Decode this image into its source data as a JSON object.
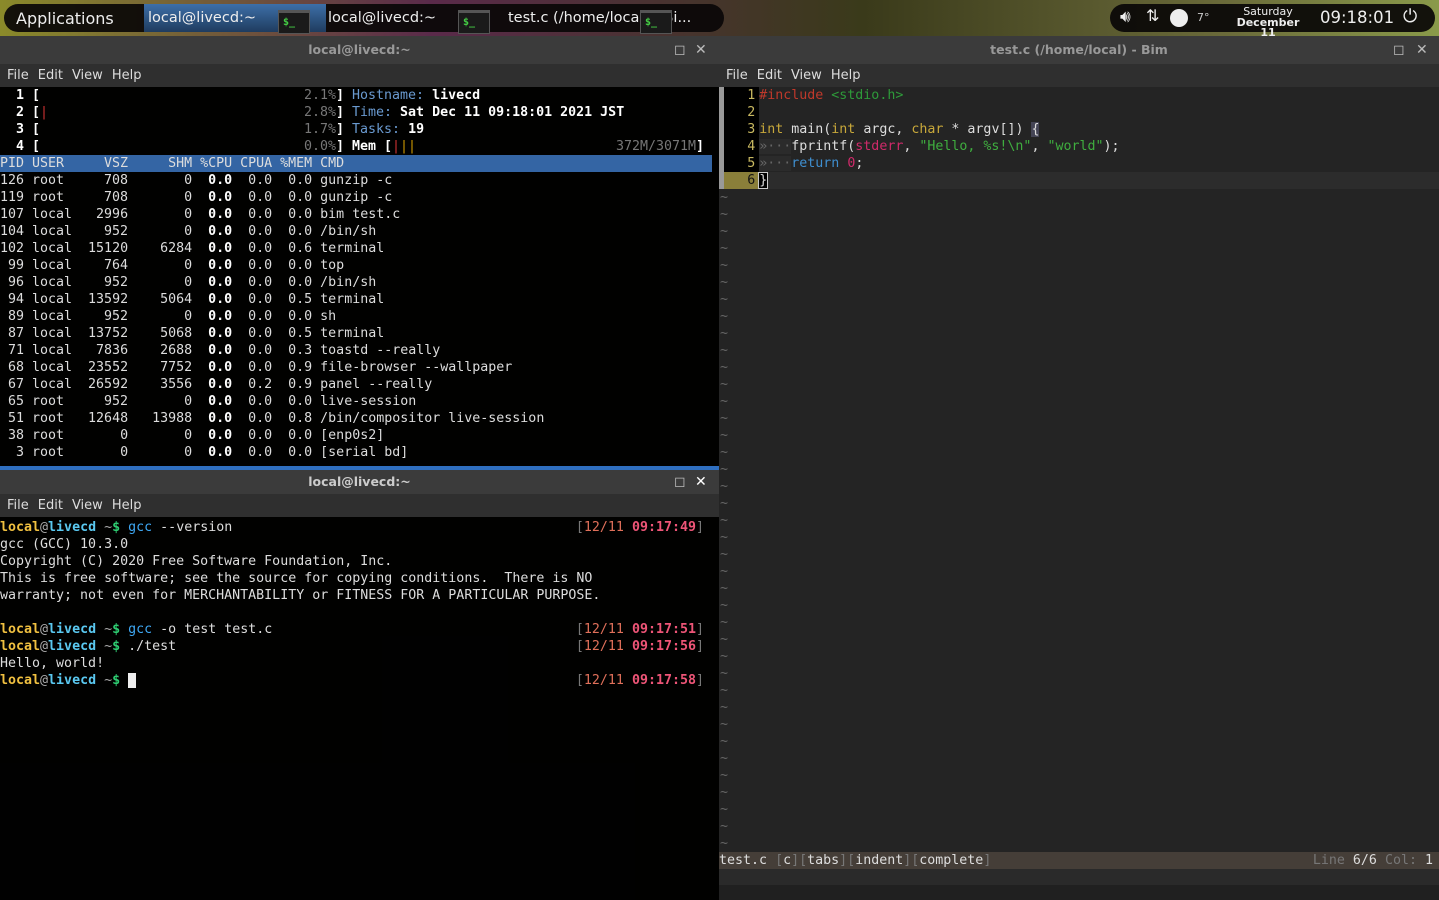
{
  "panel": {
    "applications": "Applications",
    "tasks": [
      {
        "label": "local@livecd:~",
        "active": true
      },
      {
        "label": "local@livecd:~",
        "active": false
      },
      {
        "label": "test.c (/home/local) - Bi...",
        "active": false
      }
    ],
    "task_icon": "$_",
    "weather": "7°",
    "day": "Saturday",
    "date": "December 11",
    "clock": "09:18:01",
    "icons": [
      "volume-icon",
      "network-icon",
      "weather-icon",
      "power-icon"
    ]
  },
  "top_terminal": {
    "title": "local@livecd:~",
    "menu": [
      "File",
      "Edit",
      "View",
      "Help"
    ],
    "meters": [
      {
        "n": "1",
        "pct": "2.1%"
      },
      {
        "n": "2",
        "pct": "2.8%"
      },
      {
        "n": "3",
        "pct": "1.7%"
      },
      {
        "n": "4",
        "pct": "0.0%"
      }
    ],
    "hostname_label": "Hostname:",
    "hostname": "livecd",
    "time_label": "Time:",
    "time": "Sat Dec 11 09:18:01 2021 JST",
    "tasks_label": "Tasks:",
    "tasks": "19",
    "mem_label": "Mem [",
    "mem": "372M/3071M",
    "columns": [
      "PID",
      "USER",
      "VSZ",
      "SHM",
      "%CPU",
      "CPUA",
      "%MEM",
      "CMD"
    ],
    "rows": [
      [
        "126",
        "root",
        "708",
        "0",
        "0.0",
        "0.0",
        "0.0",
        "gunzip -c"
      ],
      [
        "119",
        "root",
        "708",
        "0",
        "0.0",
        "0.0",
        "0.0",
        "gunzip -c"
      ],
      [
        "107",
        "local",
        "2996",
        "0",
        "0.0",
        "0.0",
        "0.0",
        "bim test.c"
      ],
      [
        "104",
        "local",
        "952",
        "0",
        "0.0",
        "0.0",
        "0.0",
        "/bin/sh"
      ],
      [
        "102",
        "local",
        "15120",
        "6284",
        "0.0",
        "0.0",
        "0.6",
        "terminal"
      ],
      [
        "99",
        "local",
        "764",
        "0",
        "0.0",
        "0.0",
        "0.0",
        "top"
      ],
      [
        "96",
        "local",
        "952",
        "0",
        "0.0",
        "0.0",
        "0.0",
        "/bin/sh"
      ],
      [
        "94",
        "local",
        "13592",
        "5064",
        "0.0",
        "0.0",
        "0.5",
        "terminal"
      ],
      [
        "89",
        "local",
        "952",
        "0",
        "0.0",
        "0.0",
        "0.0",
        "sh"
      ],
      [
        "87",
        "local",
        "13752",
        "5068",
        "0.0",
        "0.0",
        "0.5",
        "terminal"
      ],
      [
        "71",
        "local",
        "7836",
        "2688",
        "0.0",
        "0.0",
        "0.3",
        "toastd --really"
      ],
      [
        "68",
        "local",
        "23552",
        "7752",
        "0.0",
        "0.0",
        "0.9",
        "file-browser --wallpaper"
      ],
      [
        "67",
        "local",
        "26592",
        "3556",
        "0.0",
        "0.2",
        "0.9",
        "panel --really"
      ],
      [
        "65",
        "root",
        "952",
        "0",
        "0.0",
        "0.0",
        "0.0",
        "live-session"
      ],
      [
        "51",
        "root",
        "12648",
        "13988",
        "0.0",
        "0.0",
        "0.8",
        "/bin/compositor live-session"
      ],
      [
        "38",
        "root",
        "0",
        "0",
        "0.0",
        "0.0",
        "0.0",
        "[enp0s2]"
      ],
      [
        "3",
        "root",
        "0",
        "0",
        "0.0",
        "0.0",
        "0.0",
        "[serial bd]"
      ]
    ]
  },
  "bottom_terminal": {
    "title": "local@livecd:~",
    "menu": [
      "File",
      "Edit",
      "View",
      "Help"
    ],
    "user": "local",
    "at": "@",
    "host": "livecd",
    "cwd": " ~",
    "prompt": "$",
    "lines": [
      {
        "type": "prompt",
        "cmd": "gcc",
        "args": " --version",
        "date": "12/11",
        "time": "09:17:49"
      },
      {
        "type": "out",
        "text": "gcc (GCC) 10.3.0"
      },
      {
        "type": "out",
        "text": "Copyright (C) 2020 Free Software Foundation, Inc."
      },
      {
        "type": "out",
        "text": "This is free software; see the source for copying conditions.  There is NO"
      },
      {
        "type": "out",
        "text": "warranty; not even for MERCHANTABILITY or FITNESS FOR A PARTICULAR PURPOSE."
      },
      {
        "type": "out",
        "text": ""
      },
      {
        "type": "prompt",
        "cmd": "gcc",
        "args": " -o test test.c",
        "date": "12/11",
        "time": "09:17:51"
      },
      {
        "type": "prompt",
        "cmd": "",
        "args": "./test",
        "date": "12/11",
        "time": "09:17:56"
      },
      {
        "type": "out",
        "text": "Hello, world!"
      },
      {
        "type": "prompt",
        "cmd": "",
        "args": "",
        "date": "12/11",
        "time": "09:17:58",
        "cursor": true
      }
    ]
  },
  "editor": {
    "title": "test.c (/home/local) - Bim",
    "menu": [
      "File",
      "Edit",
      "View",
      "Help"
    ],
    "status": {
      "file": "test.c",
      "tags": [
        "c",
        "tabs",
        "indent",
        "complete"
      ],
      "line_label": "Line",
      "line": "6/6",
      "col_label": "Col:",
      "col": "1"
    }
  }
}
